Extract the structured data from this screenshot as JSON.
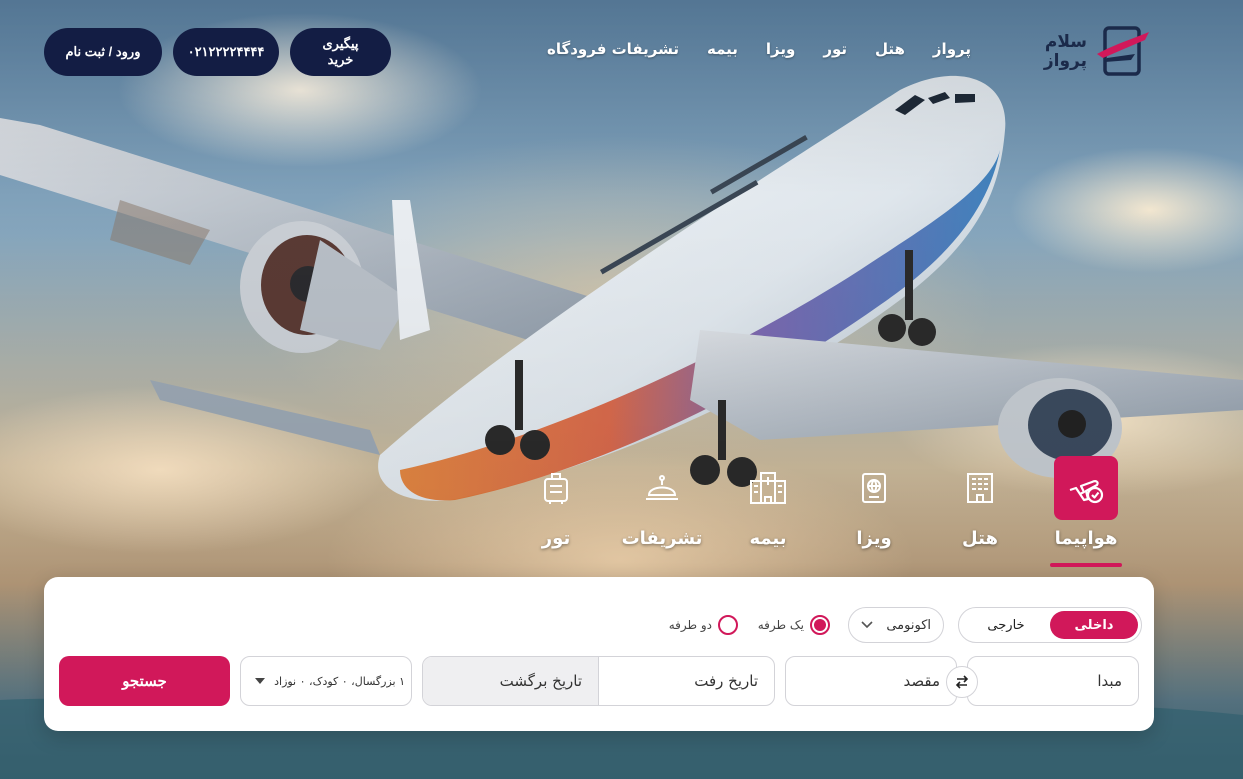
{
  "brand": {
    "line1": "سلام",
    "line2": "پرواز",
    "accent": "#d1185a",
    "navy": "#131d44"
  },
  "nav": [
    "پرواز",
    "هتل",
    "تور",
    "ویزا",
    "بیمه",
    "تشریفات فرودگاه"
  ],
  "header_buttons": {
    "track": "پیگیری خرید",
    "phone": "۰۲۱۲۲۲۲۴۴۴۴",
    "login": "ورود / ثبت نام"
  },
  "categories": [
    {
      "label": "هواپیما",
      "icon": "airplane-check-icon",
      "active": true
    },
    {
      "label": "هتل",
      "icon": "hotel-building-icon",
      "active": false
    },
    {
      "label": "ویزا",
      "icon": "passport-icon",
      "active": false
    },
    {
      "label": "بیمه",
      "icon": "hospital-icon",
      "active": false
    },
    {
      "label": "تشریفات",
      "icon": "service-bell-icon",
      "active": false
    },
    {
      "label": "تور",
      "icon": "suitcase-icon",
      "active": false
    }
  ],
  "search": {
    "domestic": "داخلی",
    "international": "خارجی",
    "cabin": "اکونومی",
    "one_way": "یک طرفه",
    "round_trip": "دو طرفه",
    "origin": "مبدا",
    "destination": "مقصد",
    "depart_date": "تاریخ رفت",
    "return_date": "تاریخ برگشت",
    "passengers": "۱ بزرگسال، ۰ کودک، ۰ نوزاد",
    "submit": "جستجو"
  }
}
